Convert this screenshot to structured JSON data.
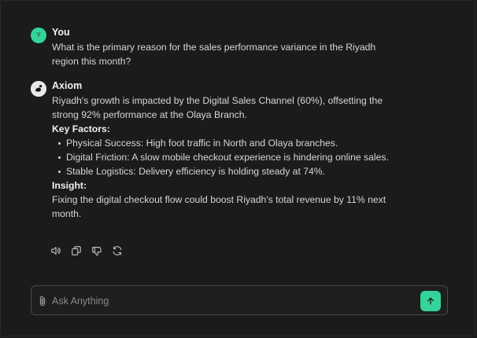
{
  "user_message": {
    "avatar_letter": "Y",
    "author": "You",
    "text": "What is the primary reason for the sales performance variance in the Riyadh region this month?"
  },
  "assistant_message": {
    "author": "Axiom",
    "intro": "Riyadh's growth is impacted by the Digital Sales Channel (60%), offsetting the strong 92% performance at the Olaya Branch.",
    "key_factors_heading": "Key Factors:",
    "factors": [
      "Physical Success: High foot traffic in North and Olaya branches.",
      "Digital Friction: A slow mobile checkout experience is hindering online sales.",
      "Stable Logistics: Delivery efficiency is holding steady at 74%."
    ],
    "insight_heading": "Insight:",
    "insight": "Fixing the digital checkout flow could boost Riyadh's total revenue by 11% next month."
  },
  "message_actions": [
    "speaker-icon",
    "copy-icon",
    "thumbs-down-icon",
    "regenerate-icon"
  ],
  "composer": {
    "placeholder": "Ask Anything",
    "value": ""
  },
  "colors": {
    "background": "#1b1b1b",
    "accent": "#34d399",
    "text": "#d6d6d6"
  }
}
